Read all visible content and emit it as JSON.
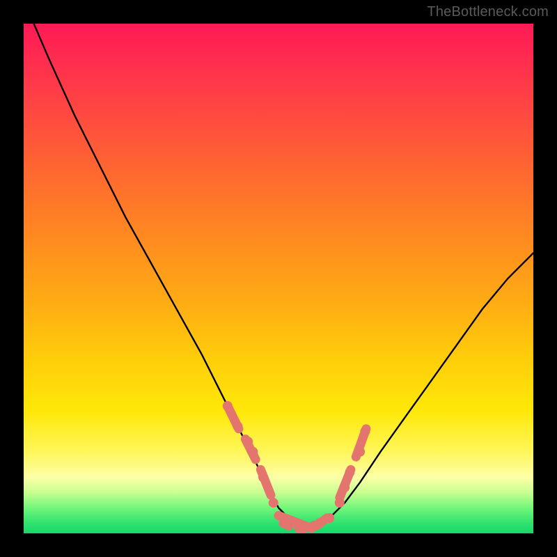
{
  "watermark": "TheBottleneck.com",
  "chart_data": {
    "type": "line",
    "title": "",
    "xlabel": "",
    "ylabel": "",
    "xlim": [
      0,
      100
    ],
    "ylim": [
      0,
      100
    ],
    "grid": false,
    "legend": false,
    "series": [
      {
        "name": "bottleneck-curve",
        "kind": "line",
        "color": "#000000",
        "x": [
          2,
          5,
          10,
          15,
          20,
          25,
          30,
          35,
          40,
          42,
          44,
          46,
          48,
          50,
          52,
          54,
          56,
          58,
          60,
          63,
          66,
          70,
          75,
          80,
          85,
          90,
          95,
          100
        ],
        "y": [
          100,
          93,
          82,
          72,
          62,
          53,
          44,
          35,
          25,
          21,
          17,
          13,
          9,
          5,
          3,
          1.5,
          1,
          1.5,
          3,
          6,
          10,
          16,
          23,
          30,
          37,
          44,
          50,
          55
        ]
      },
      {
        "name": "sample-points",
        "kind": "scatter",
        "color": "#e4756e",
        "x": [
          40,
          42,
          44,
          45,
          47,
          49,
          51,
          52,
          54,
          55,
          57,
          58,
          60,
          62,
          63,
          64,
          66,
          67
        ],
        "y": [
          25,
          21,
          18,
          16,
          11,
          6,
          2,
          1.5,
          1,
          1,
          1.5,
          2,
          3,
          6,
          9,
          12,
          16,
          20
        ]
      },
      {
        "name": "sample-segments",
        "kind": "segments",
        "color": "#e4756e",
        "segments": [
          {
            "x": [
              40,
              42.2
            ],
            "y": [
              25,
              20.5
            ]
          },
          {
            "x": [
              43.5,
              45.5
            ],
            "y": [
              18.5,
              14.5
            ]
          },
          {
            "x": [
              46.5,
              48.5
            ],
            "y": [
              12.5,
              7.5
            ]
          },
          {
            "x": [
              50.0,
              56.5
            ],
            "y": [
              3.5,
              1.0
            ]
          },
          {
            "x": [
              57.5,
              59.5
            ],
            "y": [
              1.5,
              3.0
            ]
          },
          {
            "x": [
              62.0,
              64.2
            ],
            "y": [
              7.0,
              12.5
            ]
          },
          {
            "x": [
              65.2,
              67.2
            ],
            "y": [
              15.0,
              20.5
            ]
          }
        ]
      }
    ],
    "background_gradient": {
      "orientation": "vertical",
      "stops": [
        {
          "pos": 0.0,
          "color": "#ff1a56"
        },
        {
          "pos": 0.3,
          "color": "#ff6a2e"
        },
        {
          "pos": 0.66,
          "color": "#ffce0a"
        },
        {
          "pos": 0.89,
          "color": "#fdffa6"
        },
        {
          "pos": 1.0,
          "color": "#17d86a"
        }
      ]
    }
  }
}
